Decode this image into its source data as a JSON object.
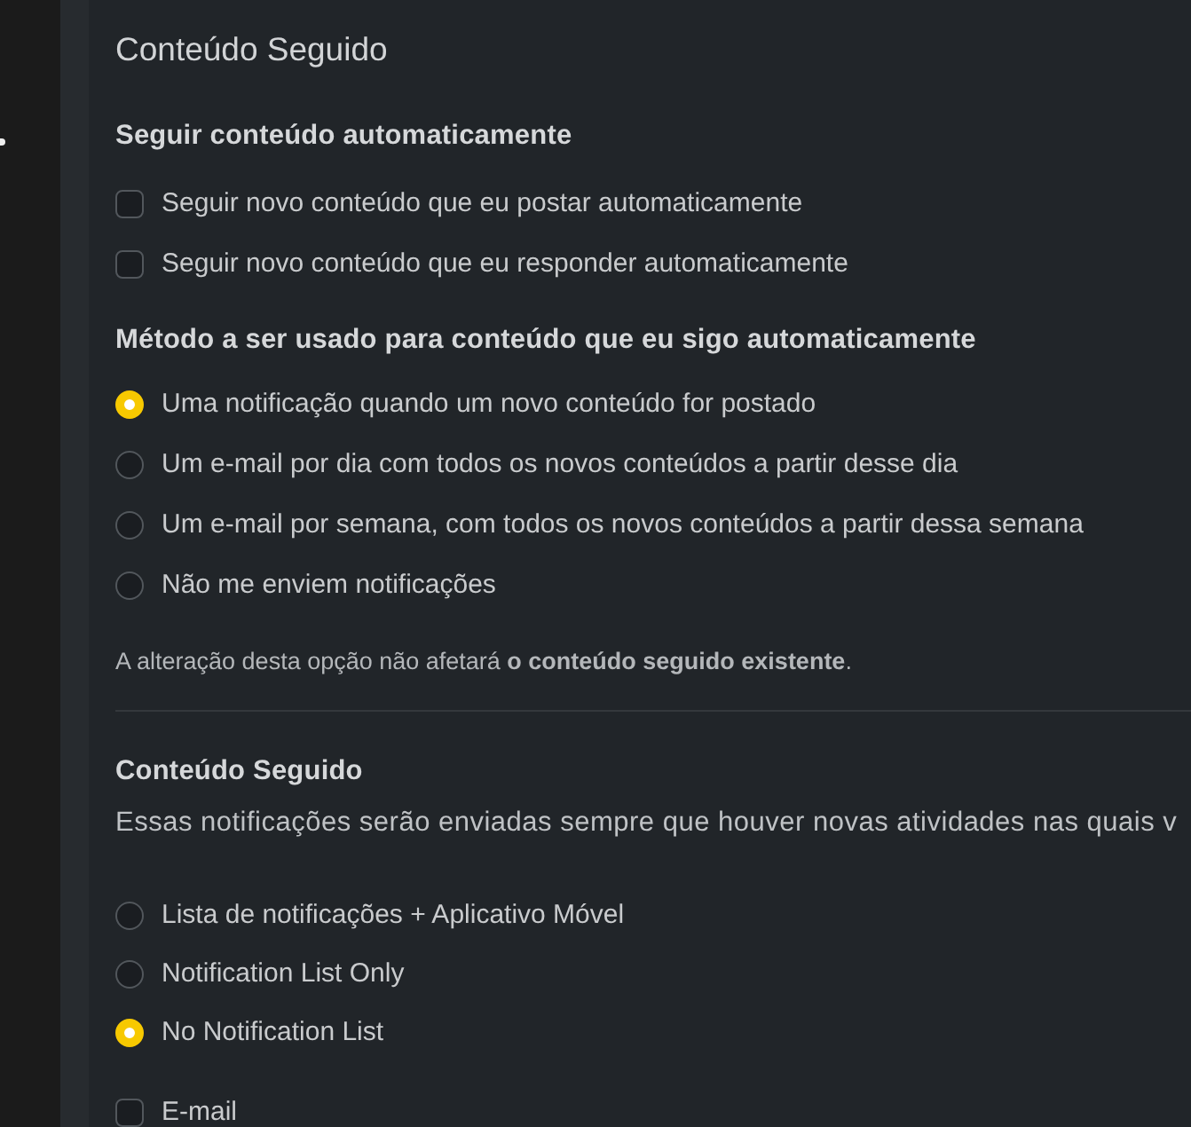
{
  "title": "Conteúdo Seguido",
  "auto_follow": {
    "heading": "Seguir conteúdo automaticamente",
    "options": [
      {
        "label": "Seguir novo conteúdo que eu postar automaticamente",
        "checked": false
      },
      {
        "label": "Seguir novo conteúdo que eu responder automaticamente",
        "checked": false
      }
    ]
  },
  "method": {
    "heading": "Método a ser usado para conteúdo que eu sigo automaticamente",
    "options": [
      {
        "label": "Uma notificação quando um novo conteúdo for postado",
        "selected": true
      },
      {
        "label": "Um e-mail por dia com todos os novos conteúdos a partir desse dia",
        "selected": false
      },
      {
        "label": "Um e-mail por semana, com todos os novos conteúdos a partir dessa semana",
        "selected": false
      },
      {
        "label": "Não me enviem notificações",
        "selected": false
      }
    ],
    "note": "A alteração desta opção não afetará **o conteúdo seguido existente**."
  },
  "followed_content": {
    "heading": "Conteúdo Seguido",
    "description": "Essas notificações serão enviadas sempre que houver novas atividades nas quais v",
    "options": [
      {
        "label": "Lista de notificações + Aplicativo Móvel",
        "selected": false
      },
      {
        "label": "Notification List Only",
        "selected": false
      },
      {
        "label": "No Notification List",
        "selected": true
      }
    ],
    "channels": [
      {
        "label": "E-mail",
        "checked": false
      }
    ]
  }
}
